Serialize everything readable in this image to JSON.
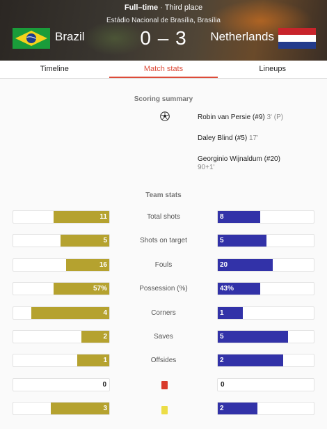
{
  "match": {
    "status": "Full–time",
    "separator": "·",
    "stage": "Third place",
    "venue": "Estádio Nacional de Brasília, Brasília",
    "home_team": "Brazil",
    "away_team": "Netherlands",
    "score": "0 – 3"
  },
  "tabs": [
    {
      "label": "Timeline"
    },
    {
      "label": "Match stats",
      "active": true
    },
    {
      "label": "Lineups"
    }
  ],
  "scoring": {
    "title": "Scoring summary",
    "goals": [
      {
        "player": "Robin van Persie (#9)",
        "minute": "3' (P)"
      },
      {
        "player": "Daley Blind (#5)",
        "minute": "17'"
      },
      {
        "player": "Georginio Wijnaldum (#20)",
        "minute": "90+1'"
      }
    ]
  },
  "team_stats": {
    "title": "Team stats",
    "rows": [
      {
        "label": "Total shots",
        "home": "11",
        "away": "8",
        "home_fraction": 0.58,
        "away_fraction": 0.44
      },
      {
        "label": "Shots on target",
        "home": "5",
        "away": "5",
        "home_fraction": 0.51,
        "away_fraction": 0.51
      },
      {
        "label": "Fouls",
        "home": "16",
        "away": "20",
        "home_fraction": 0.45,
        "away_fraction": 0.57
      },
      {
        "label": "Possession (%)",
        "home": "57%",
        "away": "43%",
        "home_fraction": 0.58,
        "away_fraction": 0.44
      },
      {
        "label": "Corners",
        "home": "4",
        "away": "1",
        "home_fraction": 0.81,
        "away_fraction": 0.26
      },
      {
        "label": "Saves",
        "home": "2",
        "away": "5",
        "home_fraction": 0.29,
        "away_fraction": 0.73
      },
      {
        "label": "Offsides",
        "home": "1",
        "away": "2",
        "home_fraction": 0.33,
        "away_fraction": 0.68
      },
      {
        "label": "",
        "icon": "red-card-icon",
        "home": "0",
        "away": "0",
        "home_fraction": 0,
        "away_fraction": 0
      },
      {
        "label": "",
        "icon": "yellow-card-icon",
        "home": "3",
        "away": "2",
        "home_fraction": 0.61,
        "away_fraction": 0.41
      }
    ]
  },
  "colors": {
    "home_bar": "#b5a22f",
    "away_bar": "#3232a8",
    "active_tab": "#dd4b39"
  }
}
